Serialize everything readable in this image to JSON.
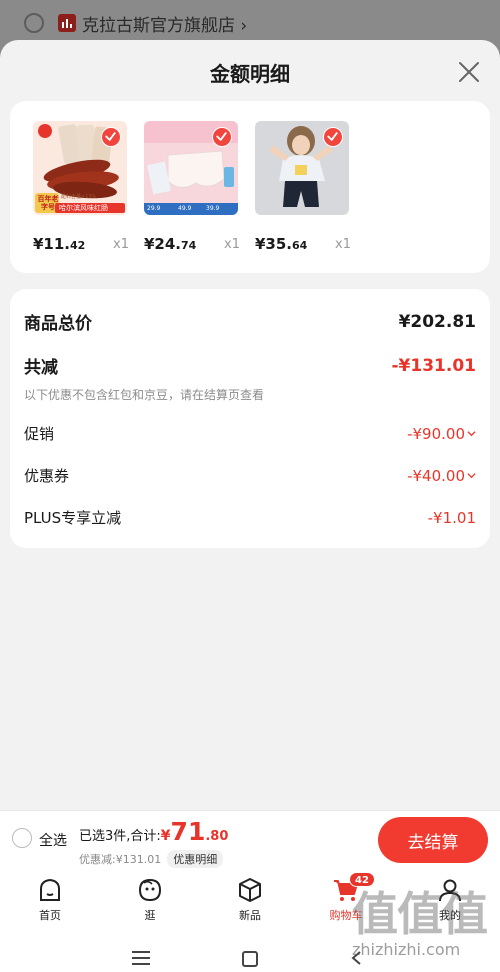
{
  "background": {
    "shop_name": "克拉古斯官方旗舰店 ›"
  },
  "sheet": {
    "title": "金额明细",
    "products": [
      {
        "price_main": "¥11.",
        "price_decimal": "42",
        "qty": "x1",
        "badge_text": "百年老字号",
        "banner_text": "哈尔滨风味红肠",
        "small_text": "配料含量≥13%"
      },
      {
        "price_main": "¥24.",
        "price_decimal": "74",
        "qty": "x1",
        "price_tags": [
          "29.9",
          "49.9",
          "39.9"
        ]
      },
      {
        "price_main": "¥35.",
        "price_decimal": "64",
        "qty": "x1"
      }
    ],
    "summary": {
      "total_label": "商品总价",
      "total_value": "¥202.81",
      "reduce_label": "共减",
      "reduce_value": "-¥131.01",
      "note": "以下优惠不包含红包和京豆，请在结算页查看",
      "items": [
        {
          "label": "促销",
          "value": "-¥90.00"
        },
        {
          "label": "优惠券",
          "value": "-¥40.00"
        },
        {
          "label": "PLUS专享立减",
          "value": "-¥1.01"
        }
      ]
    }
  },
  "bottom_bar": {
    "select_all": "全选",
    "total_prefix": "已选3件,合计:",
    "currency": "¥",
    "total_int": "71",
    "total_dec": ".80",
    "discount_text": "优惠减:¥131.01",
    "detail_button": "优惠明细",
    "checkout": "去结算"
  },
  "tabbar": {
    "tabs": [
      {
        "label": "首页",
        "icon": "home-icon"
      },
      {
        "label": "逛",
        "icon": "face-icon"
      },
      {
        "label": "新品",
        "icon": "box-icon"
      },
      {
        "label": "购物车",
        "icon": "cart-icon",
        "badge": "42",
        "active": true
      },
      {
        "label": "我的",
        "icon": "user-icon"
      }
    ]
  },
  "watermark": {
    "logo": "值值值",
    "url": "zhizhizhi.com"
  },
  "colors": {
    "accent": "#e8352b",
    "checkout_bg": "#f23b30"
  }
}
